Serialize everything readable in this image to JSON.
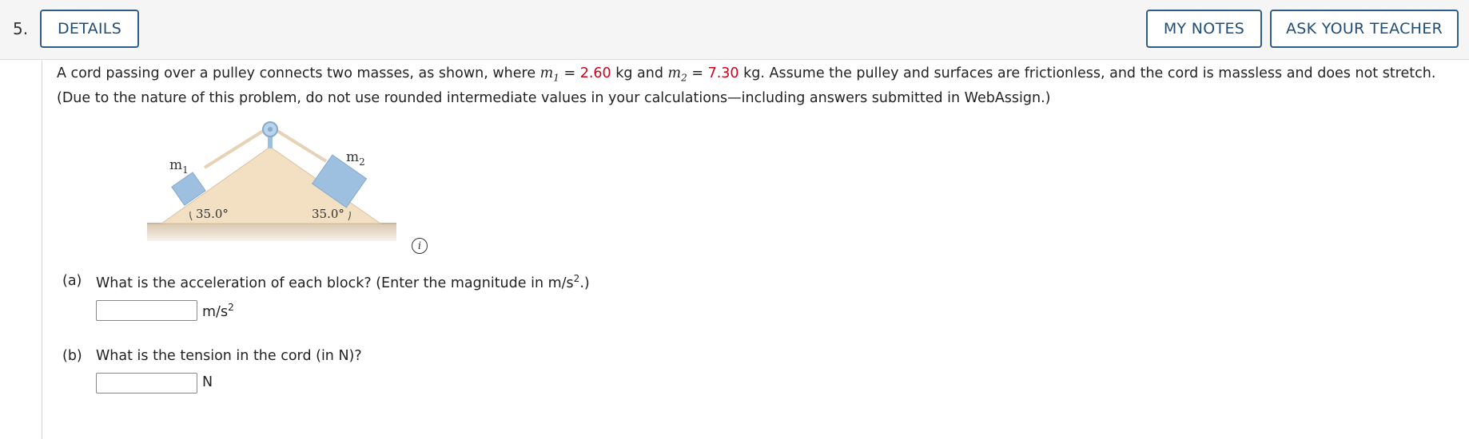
{
  "header": {
    "question_number": "5.",
    "details_label": "DETAILS",
    "my_notes_label": "MY NOTES",
    "ask_teacher_label": "ASK YOUR TEACHER"
  },
  "prompt": {
    "part1": "A cord passing over a pulley connects two masses, as shown, where ",
    "m1_var": "m",
    "m1_sub": "1",
    "eq1": " = ",
    "m1_value": "2.60",
    "kg_and": " kg and ",
    "m2_var": "m",
    "m2_sub": "2",
    "eq2": " = ",
    "m2_value": "7.30",
    "rest": " kg. Assume the pulley and surfaces are frictionless, and the cord is massless and does not stretch. (Due to the nature of this problem, do not use rounded intermediate values in your calculations—including answers submitted in WebAssign.)"
  },
  "figure": {
    "left_mass_label": "m",
    "left_mass_sub": "1",
    "right_mass_label": "m",
    "right_mass_sub": "2",
    "left_angle": "35.0°",
    "right_angle": "35.0°"
  },
  "info_icon": "i",
  "parts": [
    {
      "label": "(a)",
      "question": "What is the acceleration of each block? (Enter the magnitude in m/s",
      "question_sup": "2",
      "question_end": ".)",
      "input_value": "",
      "unit": "m/s",
      "unit_sup": "2"
    },
    {
      "label": "(b)",
      "question": "What is the tension in the cord (in N)?",
      "input_value": "",
      "unit": "N"
    }
  ],
  "colors": {
    "accent": "#2f5d8a",
    "given_value": "#d0021b",
    "incline_fill": "#f3dfc1",
    "block_fill": "#9dbfe0",
    "ground": "#d9c8b0"
  }
}
